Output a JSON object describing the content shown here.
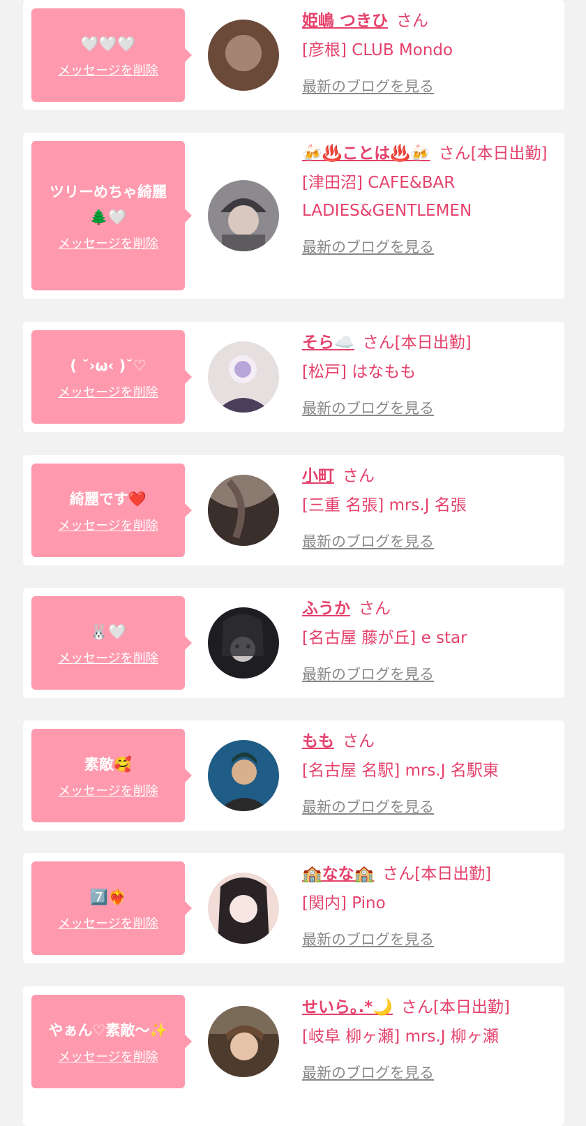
{
  "cards": [
    {
      "message": "🤍🤍🤍",
      "delete_label": "メッセージを削除",
      "name": "姫嶋 つきひ",
      "honorific": "さん",
      "status": "",
      "shop": "[彦根] CLUB Mondo",
      "blog_link": "最新のブログを見る",
      "avatar_colors": [
        "#6b4a3a",
        "#e8c9b6"
      ]
    },
    {
      "message": "ツリーめちゃ綺麗🌲🤍",
      "delete_label": "メッセージを削除",
      "name": "🍻♨️ことは♨️🍻",
      "honorific": "さん",
      "status": "[本日出勤]",
      "shop": "[津田沼] CAFE&BAR LADIES&GENTLEMEN",
      "blog_link": "最新のブログを見る",
      "avatar_colors": [
        "#5d5a60",
        "#d8c8c0"
      ]
    },
    {
      "message": "( ˘›ω‹ )˘♡",
      "delete_label": "メッセージを削除",
      "name": "そら☁️",
      "honorific": "さん",
      "status": "[本日出勤]",
      "shop": "[松戸] はなもも",
      "blog_link": "最新のブログを見る",
      "avatar_colors": [
        "#4a3f5a",
        "#e6dfe0"
      ]
    },
    {
      "message": "綺麗です❤️",
      "delete_label": "メッセージを削除",
      "name": "小町",
      "honorific": "さん",
      "status": "",
      "shop": "[三重 名張] mrs.J 名張",
      "blog_link": "最新のブログを見る",
      "avatar_colors": [
        "#3b2f2c",
        "#8a7a70"
      ]
    },
    {
      "message": "🐰🤍",
      "delete_label": "メッセージを削除",
      "name": "ふうか",
      "honorific": "さん",
      "status": "",
      "shop": "[名古屋 藤が丘] e star",
      "blog_link": "最新のブログを見る",
      "avatar_colors": [
        "#1e1e22",
        "#c9c3c4"
      ]
    },
    {
      "message": "素敵🥰",
      "delete_label": "メッセージを削除",
      "name": "もも",
      "honorific": "さん",
      "status": "",
      "shop": "[名古屋 名駅] mrs.J 名駅東",
      "blog_link": "最新のブログを見る",
      "avatar_colors": [
        "#1f5c86",
        "#d9b08c"
      ]
    },
    {
      "message": "7️⃣❤️‍🔥",
      "delete_label": "メッセージを削除",
      "name": "🏫なな🏫",
      "honorific": "さん",
      "status": "[本日出勤]",
      "shop": "[関内] Pino",
      "blog_link": "最新のブログを見る",
      "avatar_colors": [
        "#2a2326",
        "#f1dcd8"
      ]
    },
    {
      "message": "やぁん♡素敵〜✨",
      "delete_label": "メッセージを削除",
      "name": "せいら｡.*🌙",
      "honorific": "さん",
      "status": "[本日出勤]",
      "shop": "[岐阜 柳ヶ瀬] mrs.J 柳ヶ瀬",
      "blog_link": "最新のブログを見る",
      "avatar_colors": [
        "#4d3b2e",
        "#e6c2a8"
      ]
    }
  ]
}
